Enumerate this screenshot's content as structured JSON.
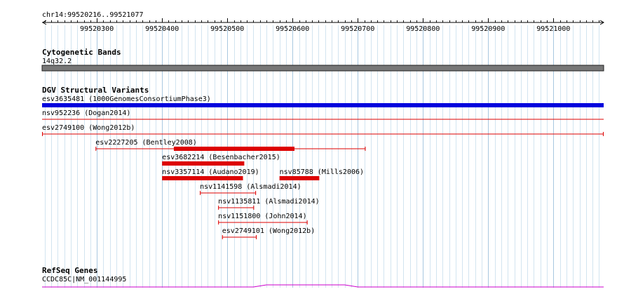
{
  "region": {
    "label": "chr14:99520216..99521077",
    "start": 99520216,
    "end": 99521077
  },
  "ruler": {
    "ticks": [
      "99520300",
      "99520400",
      "99520500",
      "99520600",
      "99520700",
      "99520800",
      "99520900",
      "99521000"
    ]
  },
  "tracks": {
    "cyto": {
      "title": "Cytogenetic Bands",
      "band": "14q32.2"
    },
    "dgv": {
      "title": "DGV Structural Variants",
      "features": [
        {
          "id": "esv3635481",
          "label": "esv3635481 (1000GenomesConsortiumPhase3)",
          "color": "#0000dd",
          "style": "thick",
          "start": 99520216,
          "end": 99521077
        },
        {
          "id": "nsv952236",
          "label": "nsv952236 (Dogan2014)",
          "color": "#dd0000",
          "style": "line",
          "start": 99520216,
          "end": 99521077
        },
        {
          "id": "esv2749100",
          "label": "esv2749100 (Wong2012b)",
          "color": "#dd0000",
          "style": "thin",
          "start": 99520216,
          "end": 99521077
        },
        {
          "id": "esv2227205",
          "label": "esv2227205 (Bentley2008)",
          "color": "#dd0000",
          "style": "thin",
          "start": 99520298,
          "end": 99520712,
          "thick_start": 99520418,
          "thick_end": 99520603
        },
        {
          "id": "esv3682214",
          "label": "esv3682214 (Besenbacher2015)",
          "color": "#dd0000",
          "style": "thick",
          "start": 99520400,
          "end": 99520526
        },
        {
          "id": "nsv3357114",
          "label": "nsv3357114 (Audano2019)",
          "color": "#dd0000",
          "style": "thick",
          "start": 99520400,
          "end": 99520524
        },
        {
          "id": "nsv85788",
          "label": "nsv85788 (Mills2006)",
          "color": "#dd0000",
          "style": "thick",
          "start": 99520580,
          "end": 99520641
        },
        {
          "id": "nsv1141598",
          "label": "nsv1141598 (Alsmadi2014)",
          "color": "#dd0000",
          "style": "thin",
          "start": 99520458,
          "end": 99520544
        },
        {
          "id": "nsv1135811",
          "label": "nsv1135811 (Alsmadi2014)",
          "color": "#dd0000",
          "style": "thin",
          "start": 99520486,
          "end": 99520541
        },
        {
          "id": "nsv1151800",
          "label": "nsv1151800 (John2014)",
          "color": "#dd0000",
          "style": "thin",
          "start": 99520486,
          "end": 99520623
        },
        {
          "id": "esv2749101",
          "label": "esv2749101 (Wong2012b)",
          "color": "#dd0000",
          "style": "thin",
          "start": 99520492,
          "end": 99520545
        }
      ]
    },
    "refseq": {
      "title": "RefSeq Genes",
      "gene": "CCDC85C|NM_001144995",
      "color": "#cc00cc"
    }
  }
}
